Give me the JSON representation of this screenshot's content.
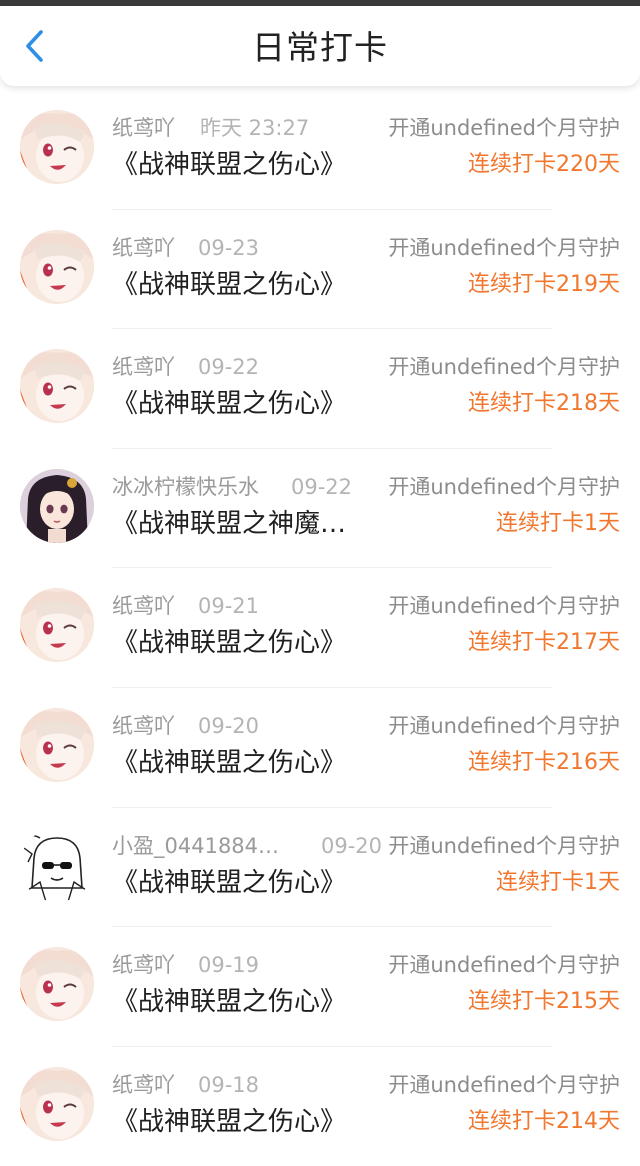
{
  "header": {
    "title": "日常打卡",
    "back_icon": "chevron-left-icon",
    "accent": "#2f8fe8"
  },
  "colors": {
    "streak": "#f2772e",
    "meta": "#9a9a9a",
    "title_text": "#1f1f1f"
  },
  "rows": [
    {
      "name": "纸鸢吖",
      "time": "昨天 23:27",
      "guard": "开通undefined个月守护",
      "book": "《战神联盟之伤心》",
      "streak": "连续打卡220天",
      "avatar": "anime-girl-wink"
    },
    {
      "name": "纸鸢吖",
      "time": "09-23",
      "guard": "开通undefined个月守护",
      "book": "《战神联盟之伤心》",
      "streak": "连续打卡219天",
      "avatar": "anime-girl-wink"
    },
    {
      "name": "纸鸢吖",
      "time": "09-22",
      "guard": "开通undefined个月守护",
      "book": "《战神联盟之伤心》",
      "streak": "连续打卡218天",
      "avatar": "anime-girl-wink"
    },
    {
      "name": "冰冰柠檬快乐水",
      "time": "09-22",
      "guard": "开通undefined个月守护",
      "book": "《战神联盟之神魔…",
      "streak": "连续打卡1天",
      "avatar": "dark-hair-girl"
    },
    {
      "name": "纸鸢吖",
      "time": "09-21",
      "guard": "开通undefined个月守护",
      "book": "《战神联盟之伤心》",
      "streak": "连续打卡217天",
      "avatar": "anime-girl-wink"
    },
    {
      "name": "纸鸢吖",
      "time": "09-20",
      "guard": "开通undefined个月守护",
      "book": "《战神联盟之伤心》",
      "streak": "连续打卡216天",
      "avatar": "anime-girl-wink"
    },
    {
      "name": "小盈_0441884…",
      "time": "09-20",
      "guard": "开通undefined个月守护",
      "book": "《战神联盟之伤心》",
      "streak": "连续打卡1天",
      "avatar": "sketch-girl-sunglasses"
    },
    {
      "name": "纸鸢吖",
      "time": "09-19",
      "guard": "开通undefined个月守护",
      "book": "《战神联盟之伤心》",
      "streak": "连续打卡215天",
      "avatar": "anime-girl-wink"
    },
    {
      "name": "纸鸢吖",
      "time": "09-18",
      "guard": "开通undefined个月守护",
      "book": "《战神联盟之伤心》",
      "streak": "连续打卡214天",
      "avatar": "anime-girl-wink"
    }
  ]
}
